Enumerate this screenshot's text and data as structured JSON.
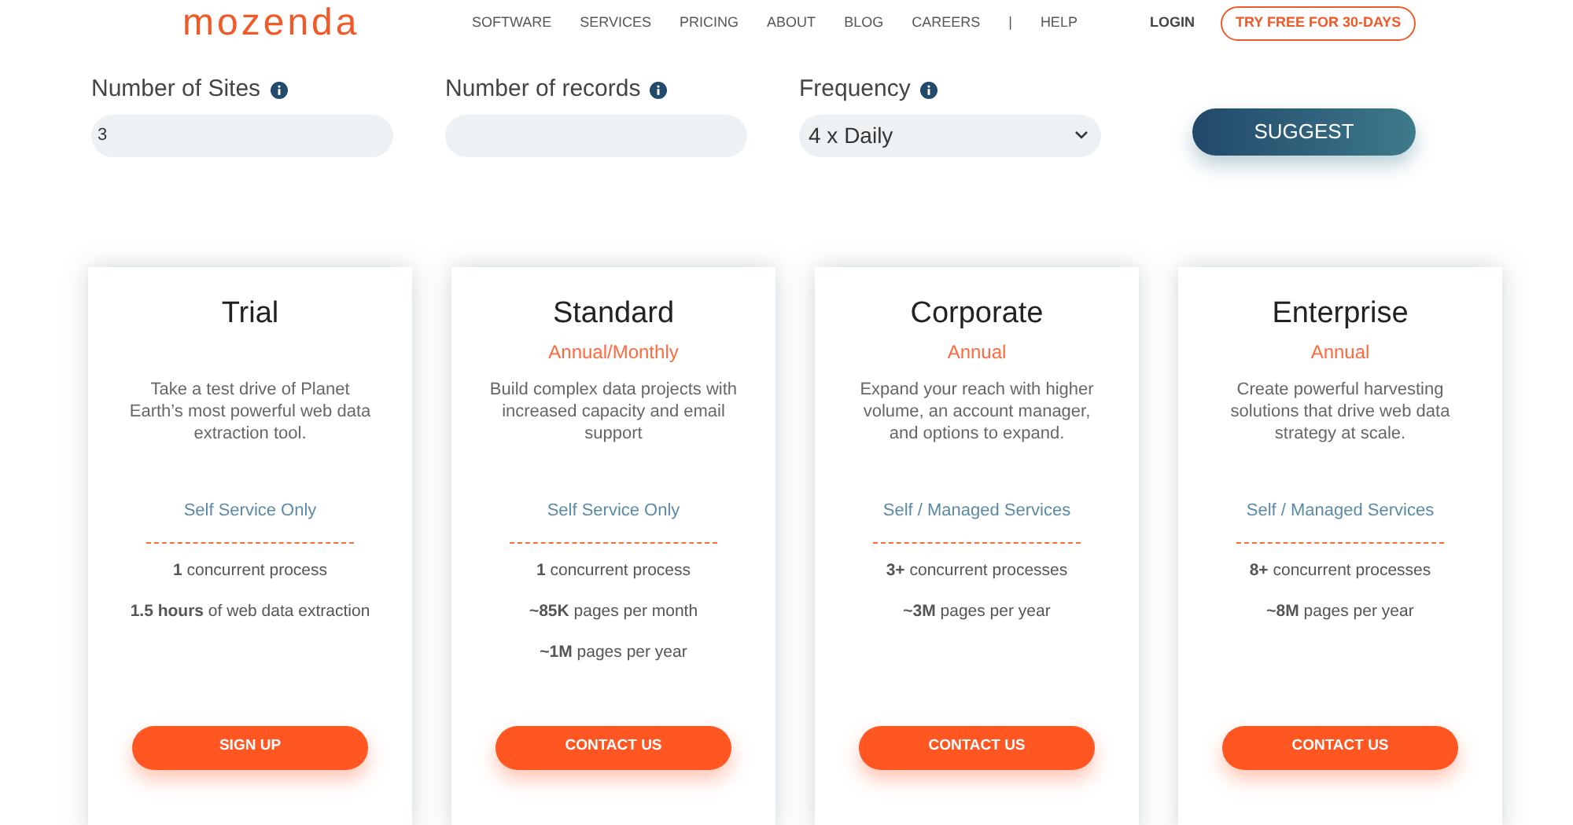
{
  "logo": "mozenda",
  "nav": [
    "SOFTWARE",
    "SERVICES",
    "PRICING",
    "ABOUT",
    "BLOG",
    "CAREERS",
    "|",
    "HELP"
  ],
  "login": "LOGIN",
  "cta": "TRY FREE FOR 30-DAYS",
  "fields": [
    {
      "kind": "input",
      "label": "Number of Sites",
      "value": "3"
    },
    {
      "kind": "input",
      "label": "Number of records"
    },
    {
      "kind": "select",
      "label": "Frequency",
      "value": "4 x Daily"
    }
  ],
  "suggest": "SUGGEST",
  "plans": [
    {
      "name": "Trial",
      "description": "Take a test drive of Planet Earth’s most powerful web data extraction tool.",
      "service": "Self Service Only",
      "features": [
        "**1** concurrent process",
        "**1.5 hours** of web data extraction"
      ],
      "button": "SIGN UP"
    },
    {
      "name": "Standard",
      "billing": "Annual/Monthly",
      "description": "Build complex data projects with increased capacity and email support",
      "service": "Self Service Only",
      "features": [
        "**1** concurrent process",
        "**~85K** pages per month",
        "**~1M** pages per year"
      ],
      "button": "CONTACT US"
    },
    {
      "name": "Corporate",
      "billing": "Annual",
      "description": "Expand your reach with higher volume, an account manager, and options to expand.",
      "service": "Self / Managed Services",
      "features": [
        "**3+** concurrent processes",
        "**~3M** pages per year"
      ],
      "button": "CONTACT US"
    },
    {
      "name": "Enterprise",
      "billing": "Annual",
      "description": "Create powerful harvesting solutions that drive web data strategy at scale.",
      "service": "Self / Managed Services",
      "features": [
        "**8+** concurrent processes",
        "**~8M** pages per year"
      ],
      "button": "CONTACT US"
    }
  ]
}
